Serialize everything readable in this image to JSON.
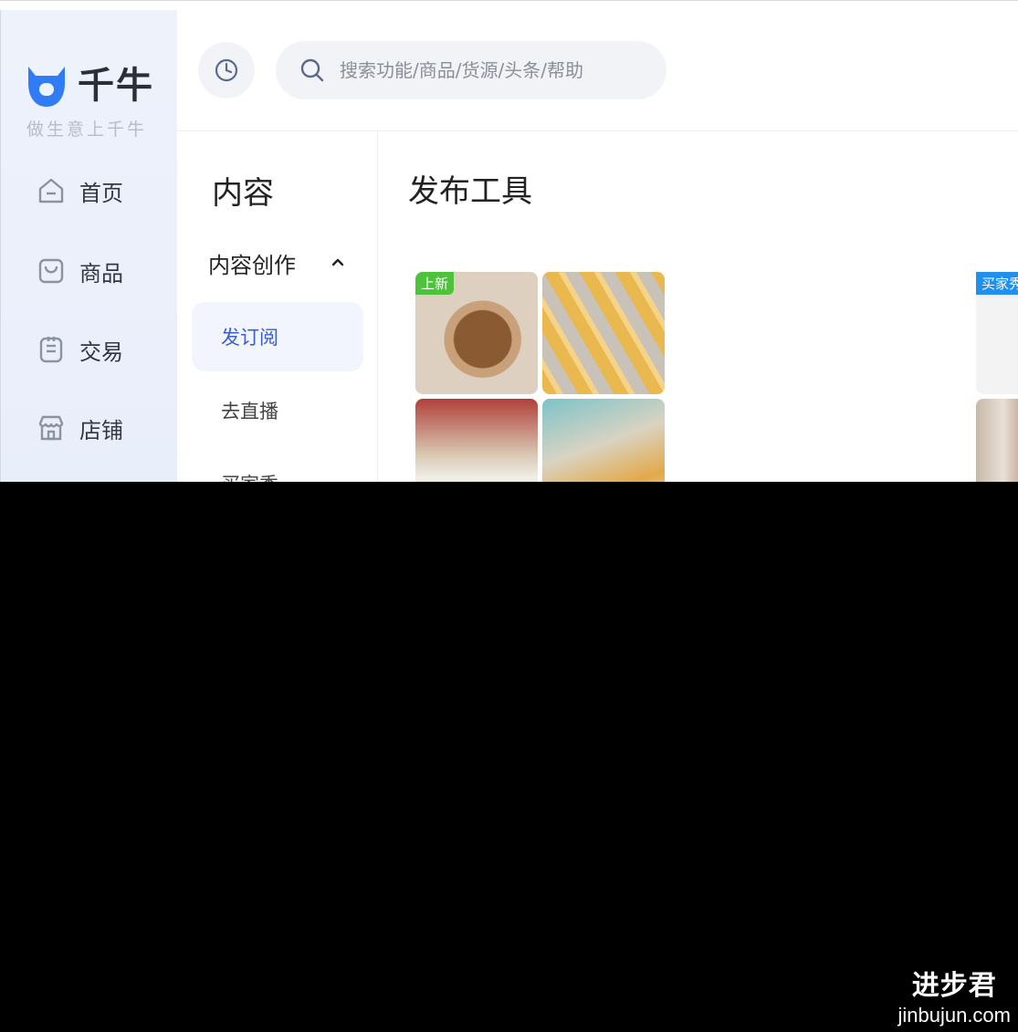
{
  "app": {
    "logo_text": "千牛",
    "slogan": "做生意上千牛",
    "brand_color": "#2f7cf6"
  },
  "search": {
    "placeholder": "搜索功能/商品/货源/头条/帮助",
    "icon": "search-icon"
  },
  "history": {
    "icon": "clock-icon"
  },
  "rail": {
    "items": [
      {
        "label": "首页",
        "icon": "home-icon"
      },
      {
        "label": "商品",
        "icon": "shopping-bag-icon"
      },
      {
        "label": "交易",
        "icon": "order-clipboard-icon"
      },
      {
        "label": "店铺",
        "icon": "store-icon"
      }
    ]
  },
  "subnav": {
    "title": "内容",
    "group": {
      "label": "内容创作",
      "expanded": true,
      "icon": "chevron-up-icon"
    },
    "items": [
      {
        "label": "发订阅",
        "active": true
      },
      {
        "label": "去直播",
        "active": false
      },
      {
        "label": "买家秀",
        "active": false
      }
    ]
  },
  "main": {
    "title": "发布工具",
    "cards": [
      {
        "badge": "上新",
        "badge_color": "#4cc33b"
      },
      {
        "badge": "买家秀",
        "badge_color": "#1f8ff0"
      }
    ]
  },
  "watermark": {
    "name": "进步君",
    "url": "jinbujun.com"
  }
}
